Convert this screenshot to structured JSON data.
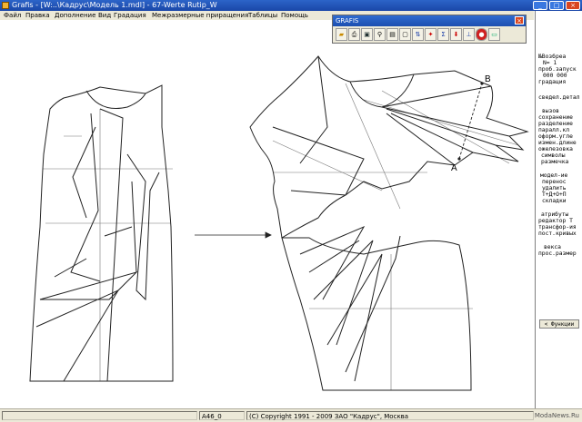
{
  "window": {
    "title": "Grafis - [W:..\\Кадрус\\Модель 1.mdl] - 67-Werte Rutip_W"
  },
  "menu": [
    "Файл",
    "Правка",
    "Дополнение",
    "Вид",
    "Градация",
    "Межразмерные приращения",
    "Таблицы",
    "Помощь"
  ],
  "toolbox": {
    "title": "GRAFIS",
    "tools": [
      "open-icon",
      "print-icon",
      "save-icon",
      "zoom-icon",
      "layers-icon",
      "page-icon",
      "sort-icon",
      "tools-icon",
      "scale-icon",
      "download-icon",
      "measure-icon",
      "stop-icon",
      "monitor-icon"
    ]
  },
  "right_panel": {
    "top": [
      "№Возбреа",
      "N=  1",
      "проб.запуск",
      "000 000",
      "градация"
    ],
    "mid1": [
      "сведел.детал"
    ],
    "group2": [
      "вызов",
      "сохранение",
      "разделение",
      "паралл.кл",
      "оформ.угле",
      "измен.длине",
      "ожелезовка",
      "символы",
      "размечка"
    ],
    "group3": [
      "модел-ие",
      "перенос",
      "удалить",
      "Т+Д+О+П",
      "складки"
    ],
    "group4": [
      "атрибуты",
      "редактор Т",
      "трансфор-ия",
      "пост.кривых"
    ],
    "group5": [
      "векса",
      "прос.размер"
    ],
    "functions_button": "< Функции"
  },
  "drawing": {
    "label_a": "A",
    "label_b": "B"
  },
  "status": {
    "cell1": "",
    "cell2": "A46_0",
    "copyright": "(C) Copyright 1991 - 2009 ЗАО \"Кадрус\", Москва",
    "watermark": "ModaNews.Ru"
  }
}
